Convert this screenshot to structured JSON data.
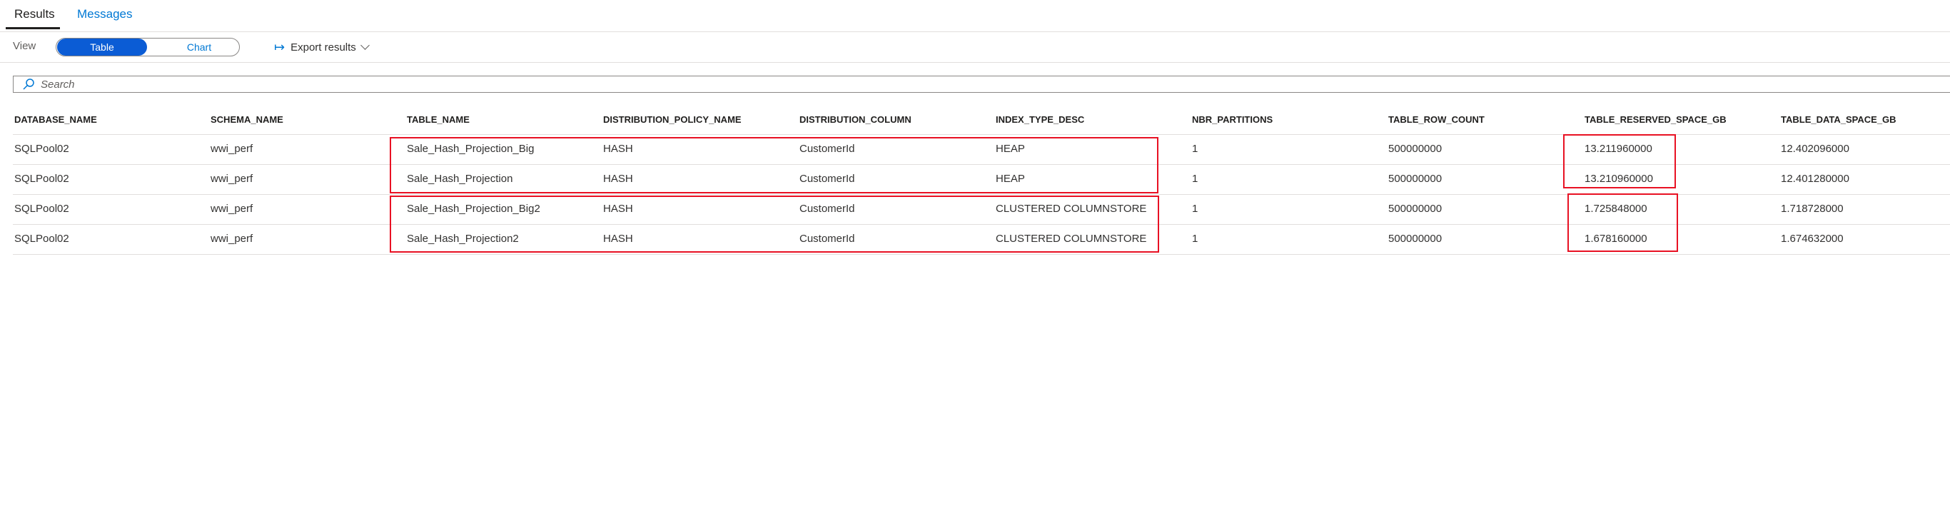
{
  "tabs": {
    "results": "Results",
    "messages": "Messages"
  },
  "toolbar": {
    "view_label": "View",
    "table": "Table",
    "chart": "Chart",
    "export": "Export results"
  },
  "search": {
    "placeholder": "Search"
  },
  "table": {
    "columns": [
      "DATABASE_NAME",
      "SCHEMA_NAME",
      "TABLE_NAME",
      "DISTRIBUTION_POLICY_NAME",
      "DISTRIBUTION_COLUMN",
      "INDEX_TYPE_DESC",
      "NBR_PARTITIONS",
      "TABLE_ROW_COUNT",
      "TABLE_RESERVED_SPACE_GB",
      "TABLE_DATA_SPACE_GB"
    ],
    "rows": [
      [
        "SQLPool02",
        "wwi_perf",
        "Sale_Hash_Projection_Big",
        "HASH",
        "CustomerId",
        "HEAP",
        "1",
        "500000000",
        "13.211960000",
        "12.402096000"
      ],
      [
        "SQLPool02",
        "wwi_perf",
        "Sale_Hash_Projection",
        "HASH",
        "CustomerId",
        "HEAP",
        "1",
        "500000000",
        "13.210960000",
        "12.401280000"
      ],
      [
        "SQLPool02",
        "wwi_perf",
        "Sale_Hash_Projection_Big2",
        "HASH",
        "CustomerId",
        "CLUSTERED COLUMNSTORE",
        "1",
        "500000000",
        "1.725848000",
        "1.718728000"
      ],
      [
        "SQLPool02",
        "wwi_perf",
        "Sale_Hash_Projection2",
        "HASH",
        "CustomerId",
        "CLUSTERED COLUMNSTORE",
        "1",
        "500000000",
        "1.678160000",
        "1.674632000"
      ]
    ]
  },
  "colors": {
    "accent": "#0078d4",
    "toggle_active": "#0b5cd5",
    "highlight": "#e81123"
  }
}
